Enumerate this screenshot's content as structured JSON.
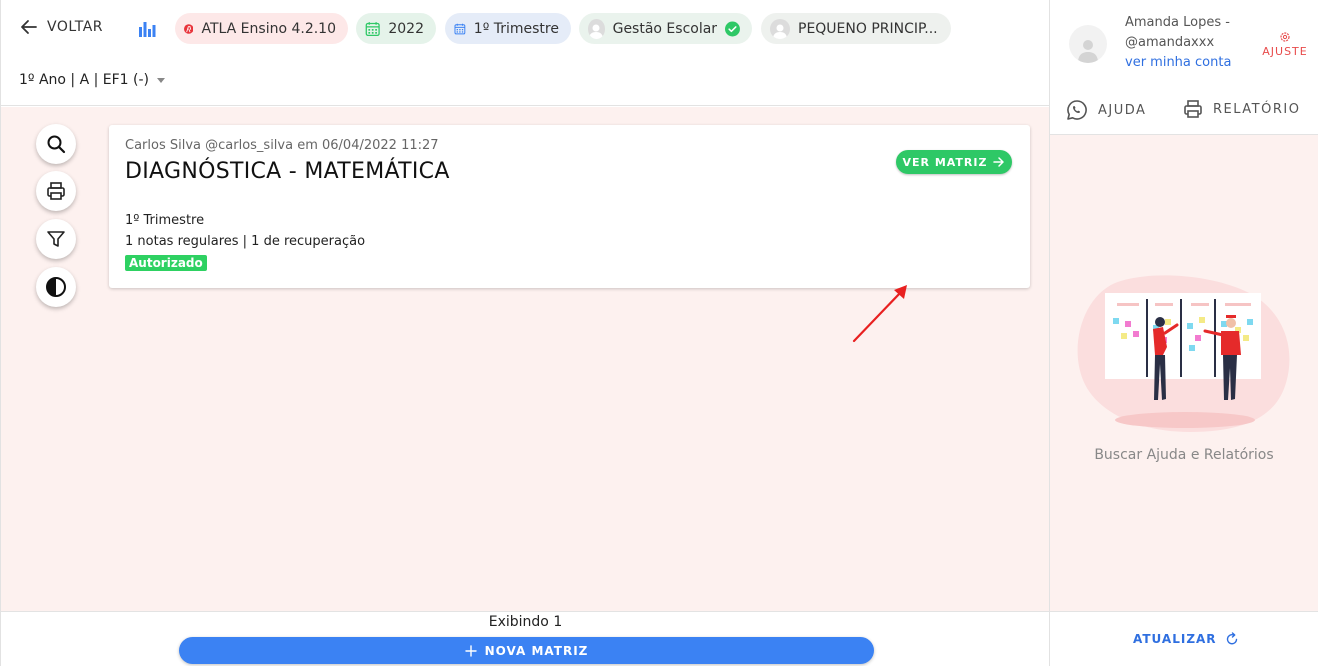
{
  "header": {
    "back_label": "VOLTAR",
    "chips": {
      "app": "ATLA Ensino 4.2.10",
      "year": "2022",
      "term": "1º Trimestre",
      "module": "Gestão Escolar",
      "school": "PEQUENO PRINCIP..."
    },
    "class_selector": "1º Ano | A | EF1 (-)"
  },
  "card": {
    "meta": "Carlos Silva @carlos_silva em 06/04/2022 11:27",
    "title": "DIAGNÓSTICA - MATEMÁTICA",
    "period": "1º Trimestre",
    "notes": "1 notas regulares | 1 de recuperação",
    "status": "Autorizado",
    "action_label": "VER MATRIZ"
  },
  "footer": {
    "count_text": "Exibindo 1",
    "new_button_label": "NOVA MATRIZ"
  },
  "sidebar": {
    "user_name": "Amanda Lopes -",
    "user_handle": "@amandaxxx",
    "account_link": "ver minha conta",
    "settings_label": "AJUSTE",
    "help_label": "AJUDA",
    "report_label": "RELATÓRIO",
    "empty_text": "Buscar Ajuda e Relatórios",
    "refresh_label": "ATUALIZAR"
  },
  "colors": {
    "accent_blue": "#3b82f3",
    "success_green": "#2ec866",
    "brand_red": "#e8333a",
    "background_pink": "#fdf1ef"
  }
}
